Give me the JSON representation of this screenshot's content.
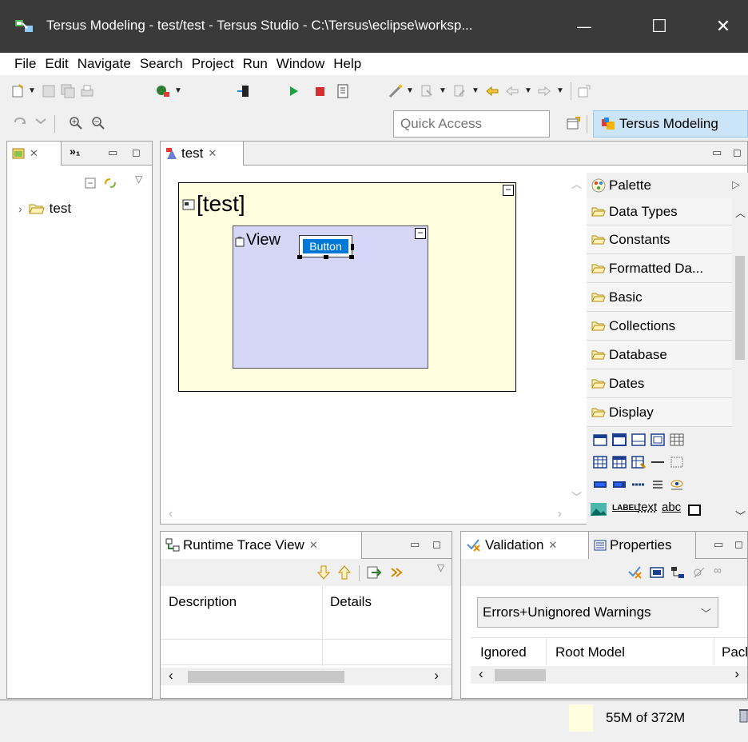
{
  "window": {
    "title": "Tersus Modeling - test/test - Tersus Studio - C:\\Tersus\\eclipse\\worksp...",
    "minimize": "—",
    "maximize": "☐",
    "close": "✕"
  },
  "menu": [
    "File",
    "Edit",
    "Navigate",
    "Search",
    "Project",
    "Run",
    "Window",
    "Help"
  ],
  "quick_access": {
    "placeholder": "Quick Access"
  },
  "perspective": {
    "label": "Tersus Modeling"
  },
  "left_panel": {
    "tabs": [
      {
        "label": "",
        "close": "✕"
      },
      {
        "label": "»₁"
      }
    ],
    "tree": [
      {
        "label": "test"
      }
    ]
  },
  "editor": {
    "tab": {
      "label": "test",
      "close": "✕"
    },
    "outer_label": "[test]",
    "inner_label": "View",
    "button_label": "Button",
    "collapse": "−"
  },
  "palette": {
    "title": "Palette",
    "drawers": [
      "Data Types",
      "Constants",
      "Formatted Da...",
      "Basic",
      "Collections",
      "Database",
      "Dates",
      "Display"
    ],
    "tools_row4": [
      "LABEL",
      "text",
      "abc"
    ]
  },
  "runtime_trace": {
    "tab": "Runtime Trace View",
    "close": "✕",
    "columns": [
      "Description",
      "Details"
    ]
  },
  "validation": {
    "tabs": [
      {
        "label": "Validation",
        "close": "✕"
      },
      {
        "label": "Properties"
      }
    ],
    "filter": "Errors+Unignored Warnings",
    "columns": [
      "Ignored",
      "Root Model",
      "Pacl"
    ]
  },
  "status": {
    "memory": "55M of 372M"
  },
  "colors": {
    "title_bar": "#3a3a3a",
    "outer_box": "#ffffe0",
    "inner_box": "#d6d6f8",
    "selection": "#0078d7",
    "perspective": "#cce4f7"
  }
}
